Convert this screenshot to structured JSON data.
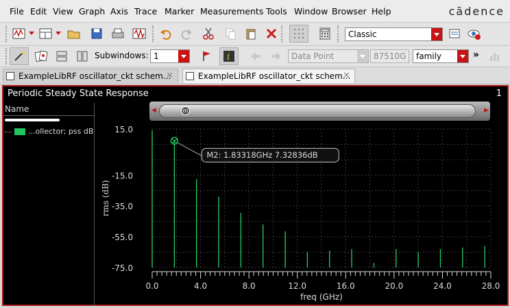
{
  "menu": [
    "File",
    "Edit",
    "View",
    "Graph",
    "Axis",
    "Trace",
    "Marker",
    "Measurements",
    "Tools",
    "Window",
    "Browser",
    "Help"
  ],
  "logo": "cādence",
  "toolbar1": {
    "style_combo": "Classic"
  },
  "toolbar2": {
    "subwindows_label": "Subwindows:",
    "subwindows_value": "1",
    "marker_type": "Data Point",
    "marker_value": "87510G",
    "family": "family",
    "more": "»"
  },
  "tabs": [
    {
      "label": "ExampleLibRF oscillator_ckt schem...",
      "active": false
    },
    {
      "label": "ExampleLibRF oscillator_ckt schem...",
      "active": true
    }
  ],
  "plot": {
    "title": "Periodic Steady State Response",
    "subwindow_index": "1",
    "name_header": "Name",
    "legend_label": "...ollector; pss dB",
    "marker_label": "M2: 1.83318GHz 7.32836dB",
    "trace_color": "#22c55e"
  },
  "chart_data": {
    "type": "bar",
    "xlabel": "freq (GHz)",
    "ylabel": "rms (dB)",
    "xlim": [
      0,
      28
    ],
    "ylim": [
      -75,
      15
    ],
    "xticks": [
      "0.0",
      "4.0",
      "8.0",
      "12.0",
      "16.0",
      "20.0",
      "24.0",
      "28.0"
    ],
    "yticks": [
      "15.0",
      "-15.0",
      "-35.0",
      "-55.0",
      "-75.0"
    ],
    "x": [
      0.0,
      1.833,
      3.667,
      5.5,
      7.333,
      9.167,
      11.0,
      12.833,
      14.667,
      16.5,
      18.333,
      20.167,
      22.0,
      23.833,
      25.667,
      27.5
    ],
    "values": [
      14,
      7.33,
      -17.5,
      -29,
      -39.5,
      -47,
      -51.5,
      -65,
      -64,
      -63,
      -72,
      -63,
      -65,
      -63,
      -62,
      -61
    ],
    "grid": true
  }
}
